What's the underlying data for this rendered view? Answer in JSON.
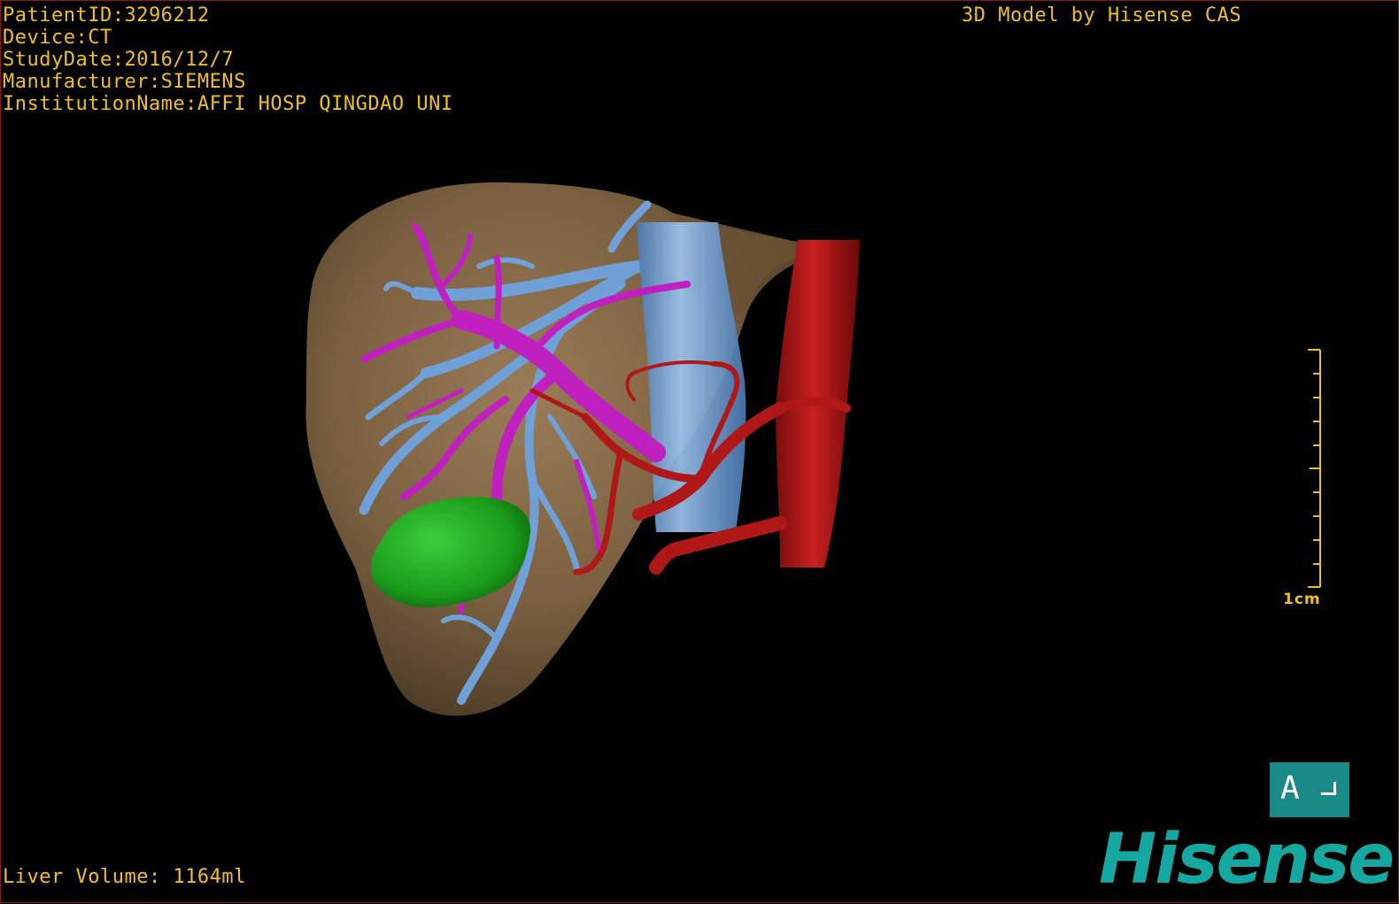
{
  "header": {
    "patient_id": "PatientID:3296212",
    "device": "Device:CT",
    "study_date": "StudyDate:2016/12/7",
    "manufacturer": "Manufacturer:SIEMENS",
    "institution": "InstitutionName:AFFI HOSP QINGDAO UNI",
    "credit": "3D Model by Hisense CAS"
  },
  "footer": {
    "liver_volume": "Liver Volume: 1164ml"
  },
  "scale": {
    "label": "1cm"
  },
  "orientation": {
    "letter": "A"
  },
  "brand": {
    "logo": "Hisense"
  },
  "colors": {
    "overlay_text": "#f0c020",
    "liver": "#7a6040",
    "portal_vein": "#c020c0",
    "hepatic_vein": "#6fa0d8",
    "artery": "#b01818",
    "tumor": "#20a020",
    "brand": "#14a8a0"
  },
  "structures": [
    "liver",
    "hepatic-vein",
    "portal-vein",
    "inferior-vena-cava",
    "aorta",
    "hepatic-artery",
    "tumor"
  ]
}
